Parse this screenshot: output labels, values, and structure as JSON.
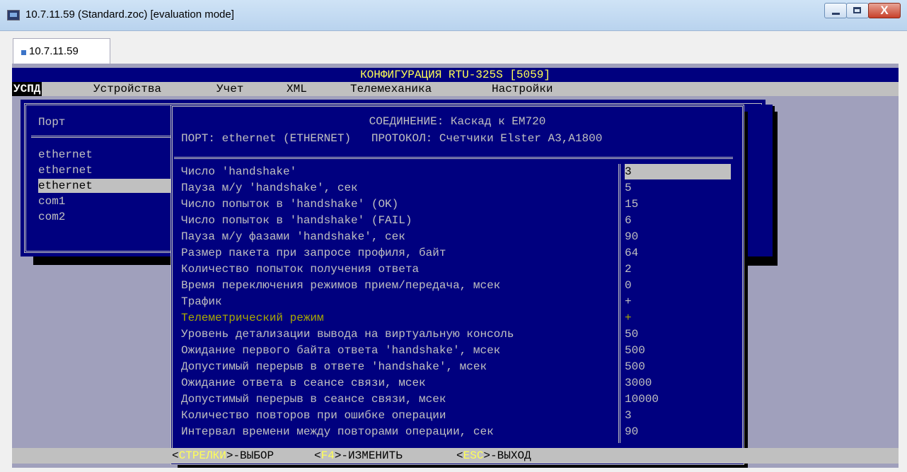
{
  "window": {
    "title": "10.7.11.59 (Standard.zoc) [evaluation mode]",
    "close_glyph": "X",
    "tab_label": "10.7.11.59"
  },
  "terminal": {
    "header": "КОНФИГУРАЦИЯ RTU-325S [5059]",
    "menu": [
      "УСПД",
      "Устройства",
      "Учет",
      "XML",
      "Телемеханика",
      "Настройки"
    ],
    "port_panel": {
      "heading": "Порт",
      "ports": [
        "ethernet",
        "ethernet",
        "ethernet",
        "com1",
        "com2"
      ],
      "selected_index": 2
    },
    "dialog": {
      "title": "СОЕДИНЕНИЕ: Каскад к EM720",
      "subtitle": "ПОРТ: ethernet (ETHERNET)   ПРОТОКОЛ: Счетчики Elster A3,A1800",
      "rows": [
        {
          "label": "Число 'handshake'",
          "value": "3"
        },
        {
          "label": "Пауза м/у 'handshake', сек",
          "value": "5"
        },
        {
          "label": "Число попыток в 'handshake' (OK)",
          "value": "15"
        },
        {
          "label": "Число попыток в 'handshake' (FAIL)",
          "value": "6"
        },
        {
          "label": "Пауза м/у фазами 'handshake', сек",
          "value": "90"
        },
        {
          "label": "Размер пакета при запросе профиля, байт",
          "value": "64"
        },
        {
          "label": "Количество попыток получения ответа",
          "value": "2"
        },
        {
          "label": "Время переключения режимов прием/передача, мсек",
          "value": "0"
        },
        {
          "label": "Трафик",
          "value": "+"
        },
        {
          "label": "Телеметрический режим",
          "value": "+"
        },
        {
          "label": "Уровень детализации вывода на виртуальную консоль",
          "value": "50"
        },
        {
          "label": "Ожидание первого байта ответа 'handshake', мсек",
          "value": "500"
        },
        {
          "label": "Допустимый перерыв в ответе 'handshake', мсек",
          "value": "500"
        },
        {
          "label": "Ожидание ответа в сеансе связи, мсек",
          "value": "3000"
        },
        {
          "label": "Допустимый перерыв в сеансе связи, мсек",
          "value": "10000"
        },
        {
          "label": "Количество повторов при ошибке операции",
          "value": "3"
        },
        {
          "label": "Интервал времени между повторами операции, сек",
          "value": "90"
        }
      ],
      "selected_row": 0,
      "highlight_row": 9
    },
    "hint_bar": {
      "k1": "СТРЕЛКИ",
      "t1": "-ВЫБОР",
      "k2": "F4",
      "t2": "-ИЗМЕНИТЬ",
      "k3": "ESC",
      "t3": "-ВЫХОД",
      "open": "<",
      "close": ">"
    },
    "colors": {
      "background": "#00007f",
      "highlight": "#aaaa00",
      "key": "#ffff55"
    }
  }
}
